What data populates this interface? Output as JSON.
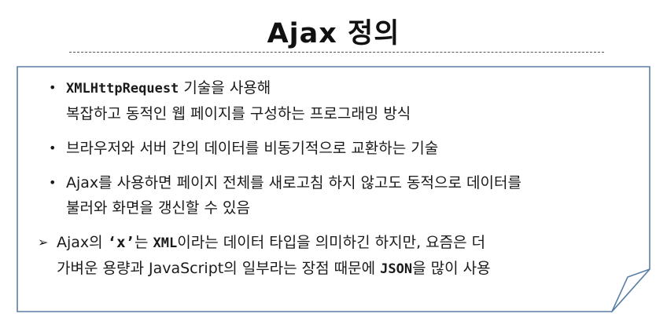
{
  "slide": {
    "title": "Ajax 정의"
  },
  "items": [
    {
      "line1_code": "XMLHttpRequest",
      "line1_rest": " 기술을 사용해",
      "line2": "복잡하고 동적인 웹 페이지를 구성하는 프로그래밍 방식"
    },
    {
      "line1": "브라우저와 서버 간의 데이터를 비동기적으로 교환하는 기술"
    },
    {
      "line1": "Ajax를 사용하면 페이지 전체를 새로고침 하지 않고도 동적으로 데이터를",
      "line2": "불러와 화면을 갱신할 수 있음"
    }
  ],
  "note": {
    "p1": "Ajax의 ",
    "quote": "‘x’",
    "p2": "는 ",
    "xml": "XML",
    "p3": "이라는 데이터 타입을 의미하긴 하지만, 요즘은 더",
    "line2_a": "가벼운 용량과 JavaScript의 일부라는 장점 때문에 ",
    "json": "JSON",
    "line2_b": "을 많이 사용"
  },
  "bullets": {
    "dot": "•",
    "arrow": "➢"
  },
  "colors": {
    "card_border": "#5a7fa6",
    "title": "#111111",
    "text": "#1a1a1a"
  }
}
